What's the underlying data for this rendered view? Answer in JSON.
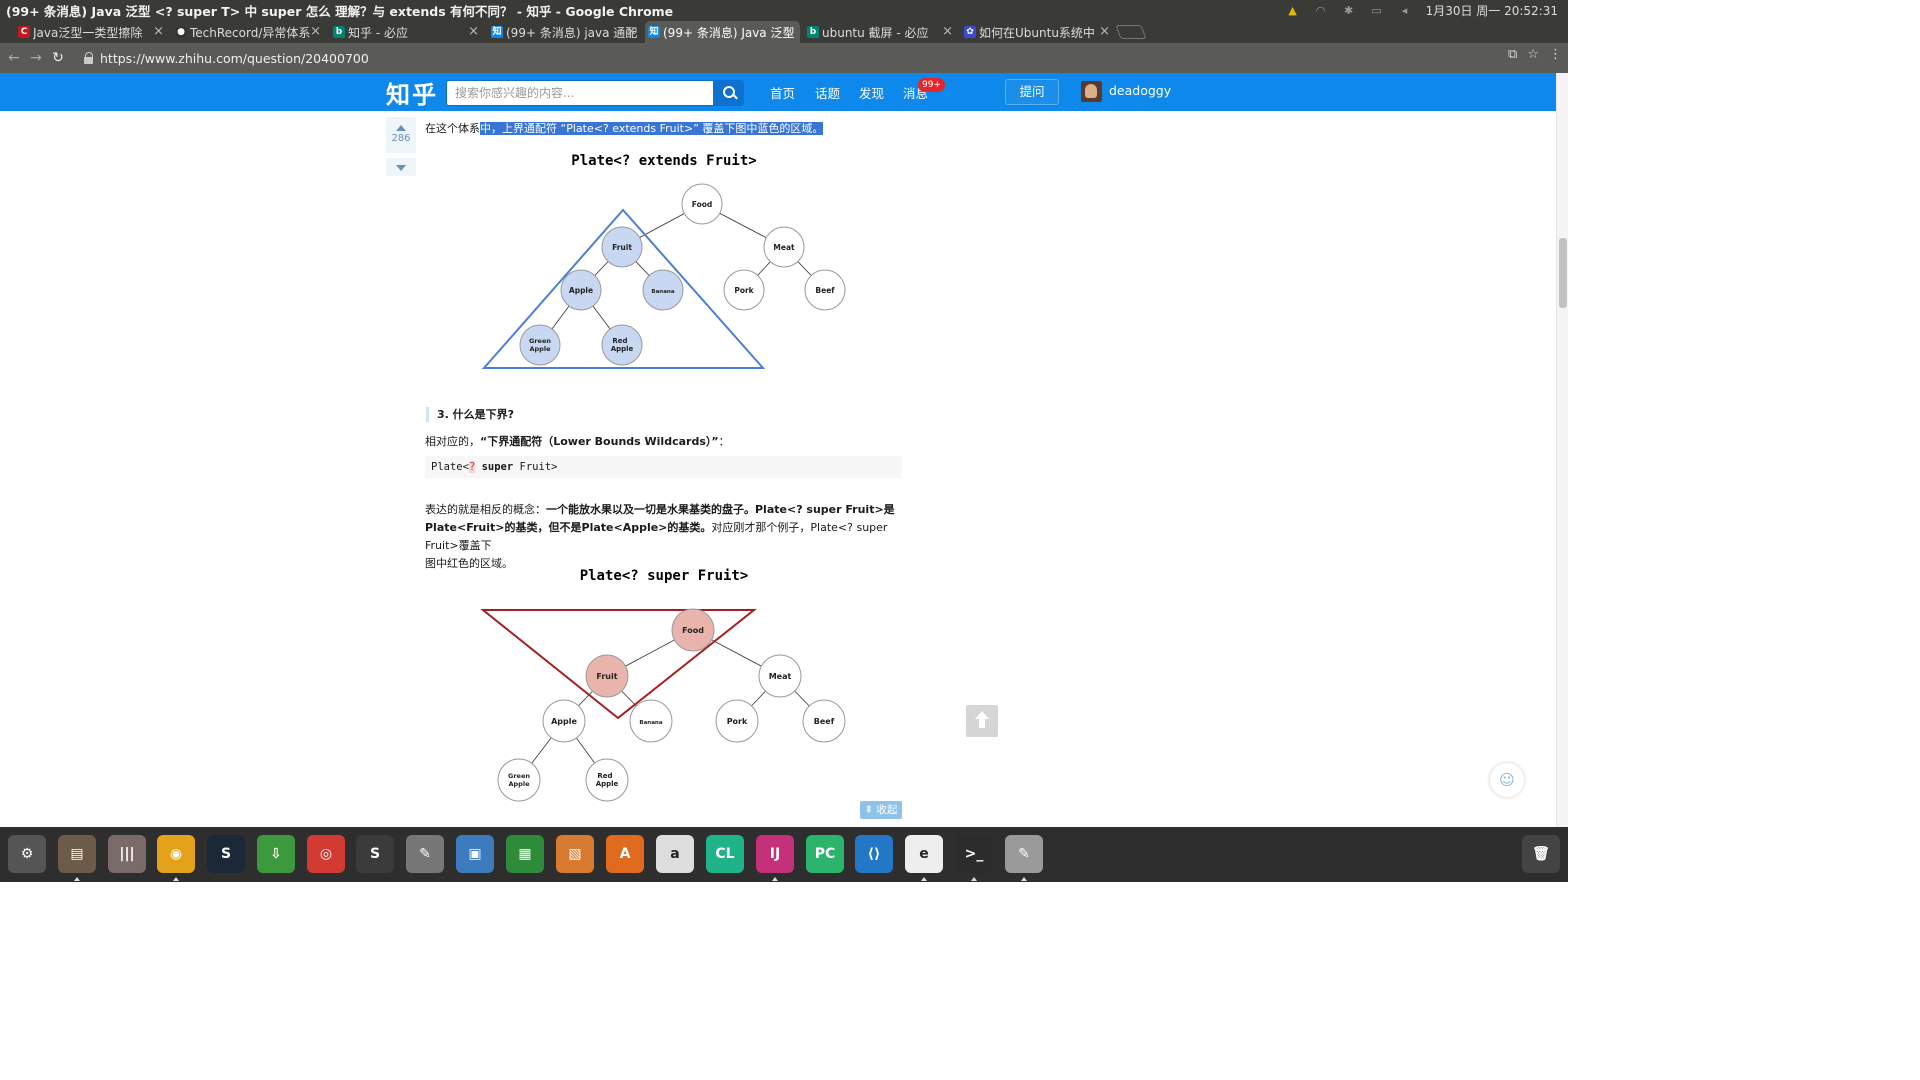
{
  "window": {
    "title": "(99+ 条消息) Java 泛型 <? super T> 中 super 怎么 理解？与 extends 有何不同？ - 知乎 - Google Chrome"
  },
  "tray": {
    "clock": "1月30日 周一 20:52:31"
  },
  "tabs": [
    {
      "label": "Java泛型一类型擦除",
      "favicon": "C",
      "color": "#c9171e",
      "active": false
    },
    {
      "label": "TechRecord/异常体系",
      "favicon": "●",
      "color": "#333333",
      "active": false
    },
    {
      "label": "知乎 - 必应",
      "favicon": "b",
      "color": "#008373",
      "active": false
    },
    {
      "label": "(99+ 条消息) java 通配",
      "favicon": "知",
      "color": "#0f88eb",
      "active": false
    },
    {
      "label": "(99+ 条消息) Java 泛型",
      "favicon": "知",
      "color": "#0f88eb",
      "active": true
    },
    {
      "label": "ubuntu 截屏 - 必应",
      "favicon": "b",
      "color": "#008373",
      "active": false
    },
    {
      "label": "如何在Ubuntu系统中",
      "favicon": "✿",
      "color": "#3b4bd1",
      "active": false
    }
  ],
  "address": {
    "url": "https://www.zhihu.com/question/20400700"
  },
  "zhihu": {
    "logo": "知乎",
    "search_placeholder": "搜索你感兴趣的内容...",
    "nav": [
      "首页",
      "话题",
      "发现",
      "消息"
    ],
    "badge": "99+",
    "ask": "提问",
    "username": "deadoggy"
  },
  "answer": {
    "votes": "286",
    "line1_pre": "在这个体系",
    "line1_hl": "中，上界通配符 “Plate<?  extends Fruit>” 覆盖下图中蓝色的区域。",
    "heading3": "3. 什么是下界?",
    "lower_pre": "相对应的，",
    "lower_bold": "“下界通配符（Lower Bounds Wildcards）”",
    "lower_post": "：",
    "code_a": "Plate<",
    "code_q": "?",
    "code_kw": "super",
    "code_b": "Fruit>",
    "p2_pre": "表达的就是相反的概念：",
    "p2_b1": "一个能放水果以及一切是水果基类的盘子。Plate<?  super Fruit>是",
    "p2_b2": "Plate<Fruit>的基类，但不是Plate<Apple>的基类。",
    "p2_post1": "对应刚才那个例子，Plate<?  super Fruit>覆盖下",
    "p2_post2": "图中红色的区域。",
    "collapse": "⇞ 收起"
  },
  "diagram1": {
    "title": "Plate<? extends Fruit>",
    "nodes": {
      "food": "Food",
      "meat": "Meat",
      "fruit": "Fruit",
      "apple": "Apple",
      "banana": "Banana",
      "pork": "Pork",
      "beef": "Beef",
      "green1": "Green",
      "green2": "Apple",
      "red1": "Red",
      "red2": "Apple"
    },
    "highlight": "#c9d8f2",
    "stroke": "#4a7fd4"
  },
  "diagram2": {
    "title": "Plate<? super Fruit>",
    "nodes": {
      "food": "Food",
      "meat": "Meat",
      "fruit": "Fruit",
      "apple": "Apple",
      "banana": "Banana",
      "pork": "Pork",
      "beef": "Beef",
      "green1": "Green",
      "green2": "Apple",
      "red1": "Red",
      "red2": "Apple"
    },
    "highlight": "#e8b4ac",
    "stroke": "#a3201e"
  },
  "dock": [
    {
      "name": "ubuntu-settings-icon",
      "label": "⚙",
      "color": "#555555"
    },
    {
      "name": "files-icon",
      "label": "▤",
      "color": "#6d5b4a"
    },
    {
      "name": "mixer-icon",
      "label": "|||",
      "color": "#7a6a6a"
    },
    {
      "name": "chrome-icon",
      "label": "◉",
      "color": "#e3a21a"
    },
    {
      "name": "steam-icon",
      "label": "S",
      "color": "#1b2838"
    },
    {
      "name": "download-icon",
      "label": "⇩",
      "color": "#3c9a3c"
    },
    {
      "name": "netease-music-icon",
      "label": "◎",
      "color": "#d33a31"
    },
    {
      "name": "sublime-icon",
      "label": "S",
      "color": "#3b3b3b"
    },
    {
      "name": "tools-icon",
      "label": "✎",
      "color": "#777777"
    },
    {
      "name": "image-viewer-icon",
      "label": "▣",
      "color": "#3d7bbf"
    },
    {
      "name": "calc-icon",
      "label": "▦",
      "color": "#2e8b3a"
    },
    {
      "name": "impress-icon",
      "label": "▧",
      "color": "#d87a30"
    },
    {
      "name": "software-center-icon",
      "label": "A",
      "color": "#e06a1e"
    },
    {
      "name": "amazon-icon",
      "label": "a",
      "color": "#dddddd"
    },
    {
      "name": "clion-icon",
      "label": "CL",
      "color": "#1fb38a"
    },
    {
      "name": "intellij-icon",
      "label": "IJ",
      "color": "#c4307a"
    },
    {
      "name": "pycharm-icon",
      "label": "PC",
      "color": "#2bb46b"
    },
    {
      "name": "vscode-icon",
      "label": "⟨⟩",
      "color": "#2377c7"
    },
    {
      "name": "cloud-icon",
      "label": "e",
      "color": "#eeeeee"
    },
    {
      "name": "terminal-icon",
      "label": ">_",
      "color": "#2c2c2c"
    },
    {
      "name": "text-editor-icon",
      "label": "✎",
      "color": "#9a9a9a"
    },
    {
      "name": "trash-icon",
      "label": "🗑",
      "color": "#444444"
    }
  ]
}
